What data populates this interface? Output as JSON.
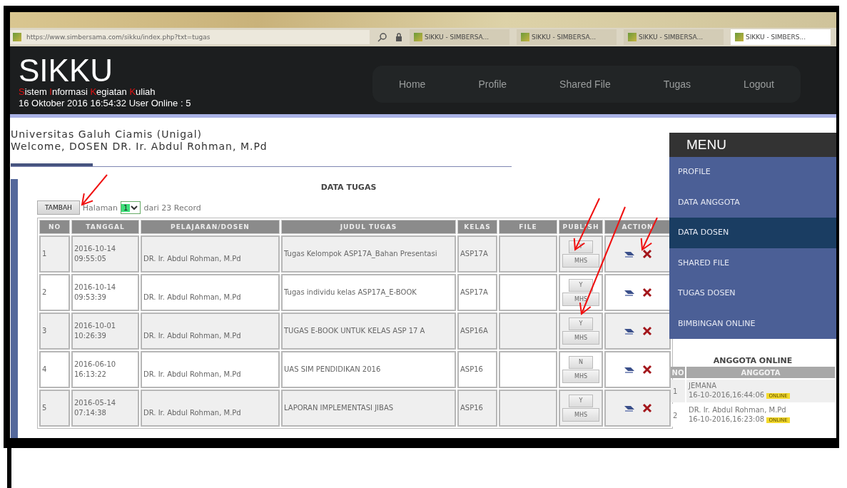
{
  "browser": {
    "address": "https://www.simbersama.com/sikku/index.php?txt=tugas",
    "tabs": [
      {
        "label": "SIKKU - SIMBERSA...",
        "selected": false
      },
      {
        "label": "SIKKU - SIMBERSA...",
        "selected": false
      },
      {
        "label": "SIKKU - SIMBERSA...",
        "selected": false
      },
      {
        "label": "SIKKU - SIMBERS...",
        "selected": true
      }
    ]
  },
  "site": {
    "logo": "SIKKU",
    "tagline": [
      "Sistem",
      "Informasi",
      "Kegiatan",
      "Kuliah"
    ],
    "status": "16 Oktober 2016 16:54:32 User Online : 5"
  },
  "nav": [
    "Home",
    "Profile",
    "Shared File",
    "Tugas",
    "Logout"
  ],
  "welcome": {
    "institution": "Universitas Galuh Ciamis (Unigal)",
    "greeting": "Welcome, DOSEN DR. Ir. Abdul Rohman, M.Pd"
  },
  "data_tugas": {
    "title": "DATA TUGAS",
    "add_button": "TAMBAH",
    "page_label": "Halaman",
    "page": "1",
    "record_count": "dari 23 Record",
    "columns": [
      "NO",
      "TANGGAL",
      "PELAJARAN/DOSEN",
      "JUDUL TUGAS",
      "KELAS",
      "FILE",
      "PUBLISH",
      "ACTION"
    ],
    "rows": [
      {
        "no": "1",
        "tanggal": "2016-10-14 09:55:05",
        "pelajaran": "DR. Ir. Abdul Rohman, M.Pd",
        "judul": "Tugas Kelompok ASP17A_Bahan Presentasi",
        "kelas": "ASP17A",
        "publish": "Y",
        "students_button": "MHS"
      },
      {
        "no": "2",
        "tanggal": "2016-10-14 09:53:39",
        "pelajaran": "DR. Ir. Abdul Rohman, M.Pd",
        "judul": "Tugas individu kelas ASP17A_E-BOOK",
        "kelas": "ASP17A",
        "publish": "Y",
        "students_button": "MHS"
      },
      {
        "no": "3",
        "tanggal": "2016-10-01 10:26:39",
        "pelajaran": "DR. Ir. Abdul Rohman, M.Pd",
        "judul": "TUGAS E-BOOK UNTUK KELAS ASP 17 A",
        "kelas": "ASP16A",
        "publish": "Y",
        "students_button": "MHS"
      },
      {
        "no": "4",
        "tanggal": "2016-06-10 16:13:22",
        "pelajaran": "DR. Ir. Abdul Rohman, M.Pd",
        "judul": "UAS SIM PENDIDIKAN 2016",
        "kelas": "ASP16",
        "publish": "N",
        "students_button": "MHS"
      },
      {
        "no": "5",
        "tanggal": "2016-05-14 07:14:38",
        "pelajaran": "DR. Ir. Abdul Rohman, M.Pd",
        "judul": "LAPORAN IMPLEMENTASI JIBAS",
        "kelas": "ASP16",
        "publish": "Y",
        "students_button": "MHS"
      }
    ]
  },
  "sidebar": {
    "title": "MENU",
    "items": [
      {
        "label": "PROFILE",
        "selected": false
      },
      {
        "label": "DATA ANGGOTA",
        "selected": false
      },
      {
        "label": "DATA DOSEN",
        "selected": true
      },
      {
        "label": "SHARED FILE",
        "selected": false
      },
      {
        "label": "TUGAS DOSEN",
        "selected": false
      },
      {
        "label": "BIMBINGAN ONLINE",
        "selected": false
      }
    ],
    "online": {
      "title": "ANGGOTA ONLINE",
      "columns": [
        "NO",
        "ANGGOTA"
      ],
      "rows": [
        {
          "no": "1",
          "name": "JEMANA",
          "time": "16-10-2016,16:44:06",
          "badge": "ONLINE"
        },
        {
          "no": "2",
          "name": "DR. Ir. Abdul Rohman, M.Pd",
          "time": "16-10-2016,16:23:08",
          "badge": "ONLINE"
        }
      ]
    }
  }
}
